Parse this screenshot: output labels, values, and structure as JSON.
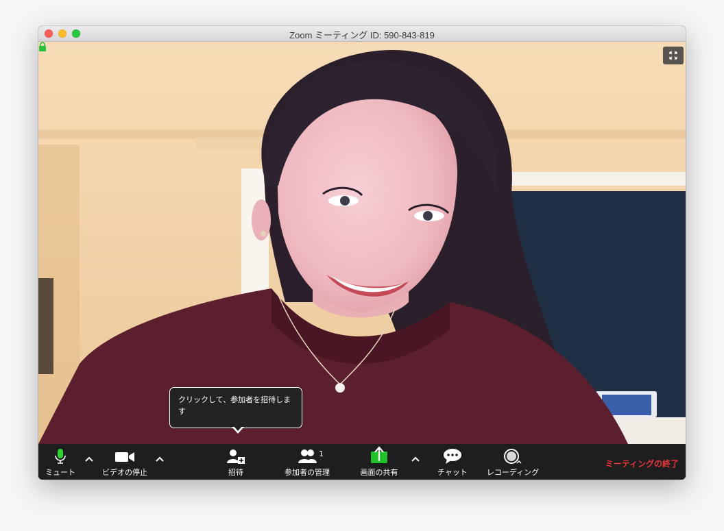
{
  "window": {
    "title": "Zoom ミーティング ID: 590-843-819"
  },
  "tooltip": {
    "text": "クリックして、参加者を招待します"
  },
  "toolbar": {
    "mute_label": "ミュート",
    "video_label": "ビデオの停止",
    "invite_label": "招待",
    "participants_label": "参加者の管理",
    "participants_count": "1",
    "share_label": "画面の共有",
    "chat_label": "チャット",
    "record_label": "レコーディング",
    "end_label": "ミーティングの終了"
  },
  "colors": {
    "share_green": "#21c12b",
    "end_red": "#e8343c",
    "mic_green": "#2fd22f",
    "lock_green": "#27c23a"
  },
  "icons": {
    "lock": "lock-icon",
    "fullscreen": "fullscreen-icon",
    "mic": "microphone-icon",
    "video": "video-camera-icon",
    "invite": "add-user-icon",
    "participants": "participants-icon",
    "share": "share-screen-icon",
    "chat": "chat-bubble-icon",
    "record": "record-icon",
    "caret": "chevron-up-icon"
  }
}
